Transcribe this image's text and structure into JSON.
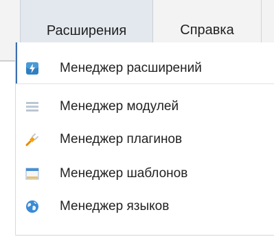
{
  "menubar": {
    "tabs": [
      {
        "label": "Расширения",
        "active": true
      },
      {
        "label": "Справка",
        "active": false
      }
    ]
  },
  "dropdown": {
    "items": [
      {
        "label": "Менеджер расширений",
        "icon": "lightning-icon"
      },
      {
        "label": "Менеджер модулей",
        "icon": "modules-icon"
      },
      {
        "label": "Менеджер плагинов",
        "icon": "plug-icon"
      },
      {
        "label": "Менеджер шаблонов",
        "icon": "template-icon"
      },
      {
        "label": "Менеджер языков",
        "icon": "globe-icon"
      }
    ]
  },
  "colors": {
    "active_tab_bg": "#e3e8ee",
    "menubar_bg": "#f3f3f3",
    "accent": "#3b6fb0"
  }
}
